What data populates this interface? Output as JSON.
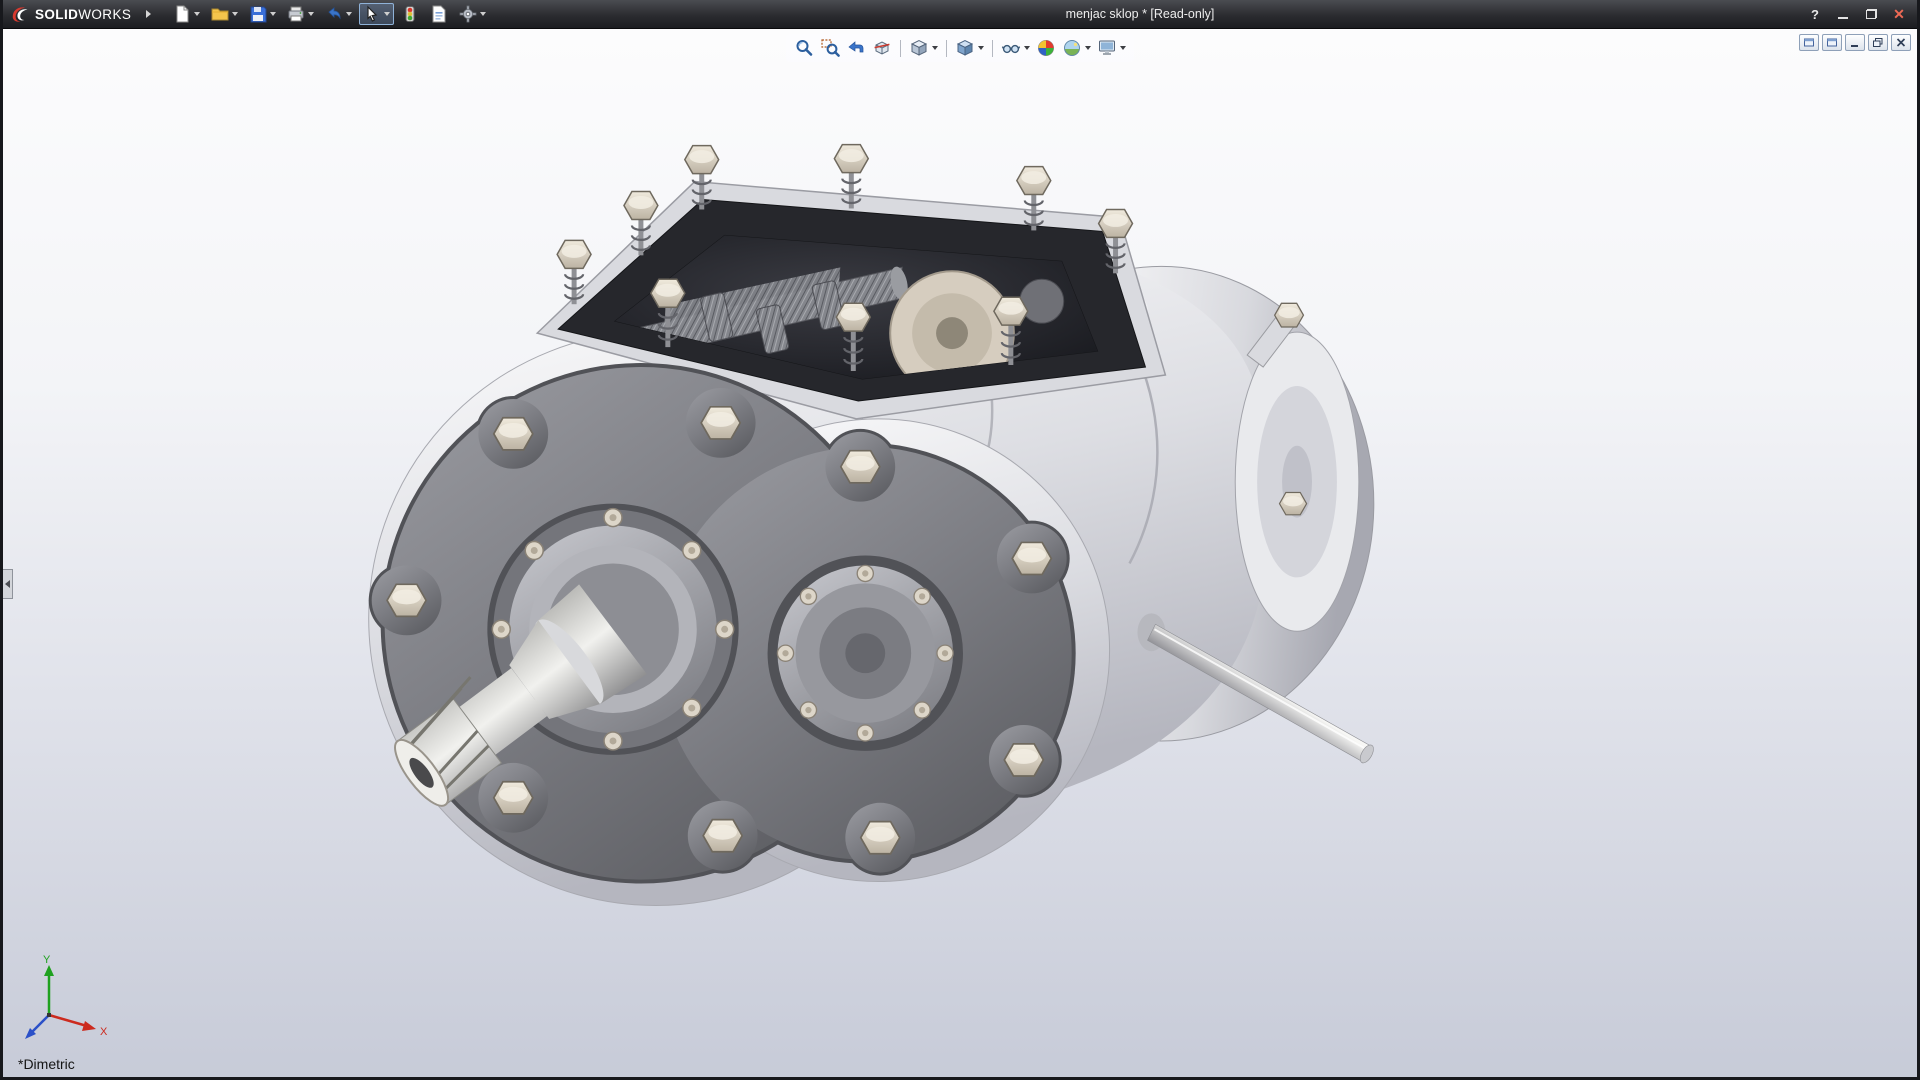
{
  "titlebar": {
    "brand_solid": "SOLID",
    "brand_works": "WORKS",
    "title": "menjac sklop * [Read-only]",
    "help_glyph": "?",
    "close_glyph": "✕",
    "tools": [
      {
        "id": "new-document",
        "icon": "page-icon",
        "dropdown": true
      },
      {
        "id": "open",
        "icon": "folder-icon",
        "dropdown": true
      },
      {
        "id": "save",
        "icon": "floppy-icon",
        "dropdown": true
      },
      {
        "id": "print",
        "icon": "printer-icon",
        "dropdown": true
      },
      {
        "id": "undo",
        "icon": "undo-arrow-icon",
        "dropdown": true
      },
      {
        "id": "select",
        "icon": "cursor-icon",
        "dropdown": true,
        "active": true
      },
      {
        "id": "rebuild",
        "icon": "traffic-light-icon"
      },
      {
        "id": "file-properties",
        "icon": "file-properties-icon"
      },
      {
        "id": "options",
        "icon": "options-icon",
        "dropdown": true
      }
    ]
  },
  "headsup": {
    "tools": [
      {
        "id": "zoom-to-fit",
        "icon": "magnifier-icon"
      },
      {
        "id": "zoom-to-area",
        "icon": "zoom-area-icon"
      },
      {
        "id": "previous-view",
        "icon": "previous-view-icon"
      },
      {
        "id": "section-view",
        "icon": "section-view-icon"
      },
      {
        "type": "separator"
      },
      {
        "id": "view-orientation",
        "icon": "view-cube-icon",
        "dropdown": true
      },
      {
        "type": "separator"
      },
      {
        "id": "display-style",
        "icon": "display-style-icon",
        "dropdown": true
      },
      {
        "type": "separator"
      },
      {
        "id": "hide-show-items",
        "icon": "hide-show-icon",
        "dropdown": true
      },
      {
        "id": "edit-appearance",
        "icon": "appearance-sphere-icon"
      },
      {
        "id": "apply-scene",
        "icon": "scene-sphere-icon",
        "dropdown": true
      },
      {
        "id": "view-settings",
        "icon": "view-settings-icon",
        "dropdown": true
      }
    ]
  },
  "document_window": {
    "controls": [
      {
        "id": "window-left",
        "icon": "doc-window-icon"
      },
      {
        "id": "window-right",
        "icon": "doc-window-icon"
      },
      {
        "id": "doc-minimize",
        "icon": "doc-min-icon"
      },
      {
        "id": "doc-restore",
        "icon": "doc-restore-icon"
      },
      {
        "id": "doc-close",
        "icon": "doc-close-icon"
      }
    ]
  },
  "viewport": {
    "view_label": "*Dimetric",
    "triad": {
      "x": "X",
      "y": "Y"
    }
  },
  "colors": {
    "titlebar_bg": "#2b2c30",
    "brand_red": "#d8392f",
    "viewport_top": "#fcfcfd",
    "viewport_bottom": "#c7cbd8",
    "triad_x": "#cc2a1e",
    "triad_y": "#1fa11f",
    "triad_z": "#2b50c8"
  }
}
